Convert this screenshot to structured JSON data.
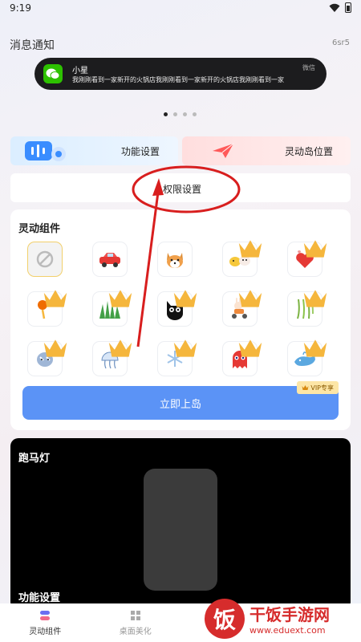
{
  "status_bar": {
    "time": "9:19"
  },
  "notification": {
    "section_title": "消息通知",
    "code": "6sr5",
    "sender": "小星",
    "message": "我刚刚看到一家新开的火锅店我刚刚看到一家新开的火锅店我刚刚看到一家",
    "app_name": "微信"
  },
  "cards": {
    "function_settings": "功能设置",
    "island_position": "灵动岛位置",
    "permission_settings": "权限设置"
  },
  "widgets": {
    "title": "灵动组件",
    "items": [
      {
        "name": "none"
      },
      {
        "name": "car"
      },
      {
        "name": "corgi"
      },
      {
        "name": "chicks",
        "vip": true
      },
      {
        "name": "hearts",
        "vip": true
      },
      {
        "name": "hourglass",
        "vip": true
      },
      {
        "name": "grass",
        "vip": true
      },
      {
        "name": "black-cat",
        "vip": true
      },
      {
        "name": "scooter-rabbit",
        "vip": true
      },
      {
        "name": "willow",
        "vip": true
      },
      {
        "name": "sloth",
        "vip": true
      },
      {
        "name": "jellyfish",
        "vip": true
      },
      {
        "name": "snowflake",
        "vip": true
      },
      {
        "name": "pac-ghost",
        "vip": true
      },
      {
        "name": "whale",
        "vip": true
      }
    ],
    "board_button": "立即上岛",
    "vip_badge": "VIP专享"
  },
  "marquee": {
    "title": "跑马灯",
    "sub_title": "功能设置"
  },
  "tabs": [
    {
      "label": "灵动组件",
      "active": true
    },
    {
      "label": "桌面美化",
      "active": false
    },
    {
      "label": "",
      "active": false
    },
    {
      "label": "",
      "active": false
    }
  ],
  "watermark": {
    "logo_char": "饭",
    "name": "干饭手游网",
    "url": "www.eduext.com"
  },
  "colors": {
    "accent_blue": "#5b93f6",
    "annotation_red": "#d81e1e",
    "wechat_green": "#2dc100"
  }
}
